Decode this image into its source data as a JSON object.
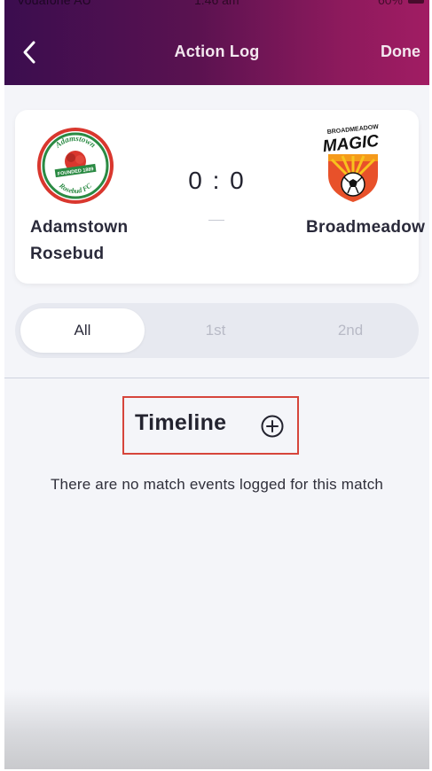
{
  "status_bar": {
    "carrier": "Vodafone AU",
    "time": "1:46 am",
    "battery": "60%"
  },
  "header": {
    "title": "Action Log",
    "done_label": "Done"
  },
  "match": {
    "home_team": "Adamstown Rosebud",
    "away_team": "Broadmeadow",
    "score": "0 : 0",
    "home_logo": {
      "top_text": "Adamstown",
      "band_text": "FOUNDED 1889",
      "bottom_text": "Rosebud FC"
    },
    "away_logo": {
      "top_text": "BROADMEADOW",
      "main_text": "MAGIC"
    }
  },
  "periods": {
    "tabs": [
      "All",
      "1st",
      "2nd"
    ],
    "selected": "All"
  },
  "timeline": {
    "title": "Timeline",
    "empty_message": "There are no match events logged for this match"
  },
  "colors": {
    "header_start": "#3b0d4f",
    "header_end": "#a11c63",
    "highlight_border": "#d6453b"
  }
}
